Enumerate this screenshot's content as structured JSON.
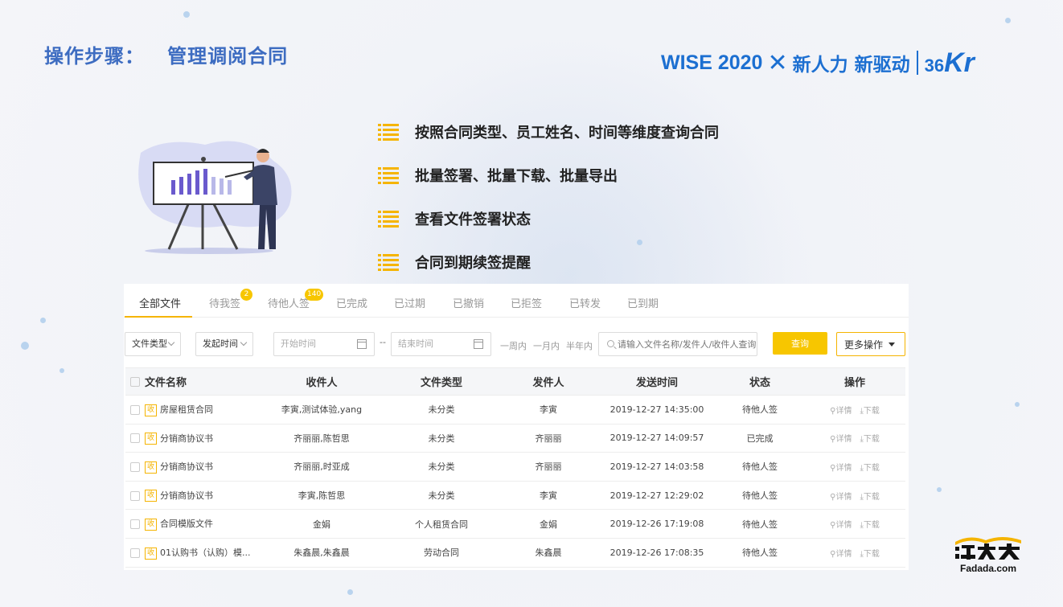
{
  "slide": {
    "title": "操作步骤：   管理调阅合同",
    "brand_left": "WISE 2020",
    "brand_middle": "新人力 新驱动",
    "brand_num": "36",
    "brand_kr": "Kr"
  },
  "features": [
    {
      "label": "按照合同类型、员工姓名、时间等维度查询合同",
      "icon": "list-icon"
    },
    {
      "label": "批量签署、批量下载、批量导出",
      "icon": "list-icon"
    },
    {
      "label": "查看文件签署状态",
      "icon": "list-icon"
    },
    {
      "label": "合同到期续签提醒",
      "icon": "list-icon"
    }
  ],
  "tabs": [
    {
      "label": "全部文件",
      "active": true
    },
    {
      "label": "待我签",
      "badge": "2"
    },
    {
      "label": "待他人签",
      "badge": "140"
    },
    {
      "label": "已完成"
    },
    {
      "label": "已过期"
    },
    {
      "label": "已撤销"
    },
    {
      "label": "已拒签"
    },
    {
      "label": "已转发"
    },
    {
      "label": "已到期"
    }
  ],
  "filters": {
    "file_type": "文件类型",
    "send_time": "发起时间",
    "start_placeholder": "开始时间",
    "end_placeholder": "结束时间",
    "range_sep": "--",
    "quick_week": "一周内",
    "quick_month": "一月内",
    "quick_half_year": "半年内",
    "search_placeholder": "请输入文件名称/发件人/收件人查询",
    "query_label": "查询",
    "more_label": "更多操作"
  },
  "table": {
    "headers": [
      "文件名称",
      "收件人",
      "文件类型",
      "发件人",
      "发送时间",
      "状态",
      "操作"
    ],
    "recv_tag": "收",
    "detail_label": "详情",
    "download_label": "下载",
    "rows": [
      {
        "name": "房屋租赁合同",
        "recipients": "李寅,测试体验,yang",
        "type": "未分类",
        "sender": "李寅",
        "time": "2019-12-27 14:35:00",
        "status": "待他人签"
      },
      {
        "name": "分销商协议书",
        "recipients": "齐丽丽,陈哲思",
        "type": "未分类",
        "sender": "齐丽丽",
        "time": "2019-12-27 14:09:57",
        "status": "已完成"
      },
      {
        "name": "分销商协议书",
        "recipients": "齐丽丽,时亚成",
        "type": "未分类",
        "sender": "齐丽丽",
        "time": "2019-12-27 14:03:58",
        "status": "待他人签"
      },
      {
        "name": "分销商协议书",
        "recipients": "李寅,陈哲思",
        "type": "未分类",
        "sender": "李寅",
        "time": "2019-12-27 12:29:02",
        "status": "待他人签"
      },
      {
        "name": "合同模版文件",
        "recipients": "金娟",
        "type": "个人租赁合同",
        "sender": "金娟",
        "time": "2019-12-26 17:19:08",
        "status": "待他人签"
      },
      {
        "name": "01认购书（认购）模...",
        "recipients": "朱鑫晨,朱鑫晨",
        "type": "劳动合同",
        "sender": "朱鑫晨",
        "time": "2019-12-26 17:08:35",
        "status": "待他人签"
      }
    ]
  },
  "logo": {
    "text": "Fadada.com",
    "mark": "法大大"
  },
  "colors": {
    "title_blue": "#3d6cc1",
    "brand_blue": "#1c6fd1",
    "accent_yellow": "#f7c600"
  }
}
